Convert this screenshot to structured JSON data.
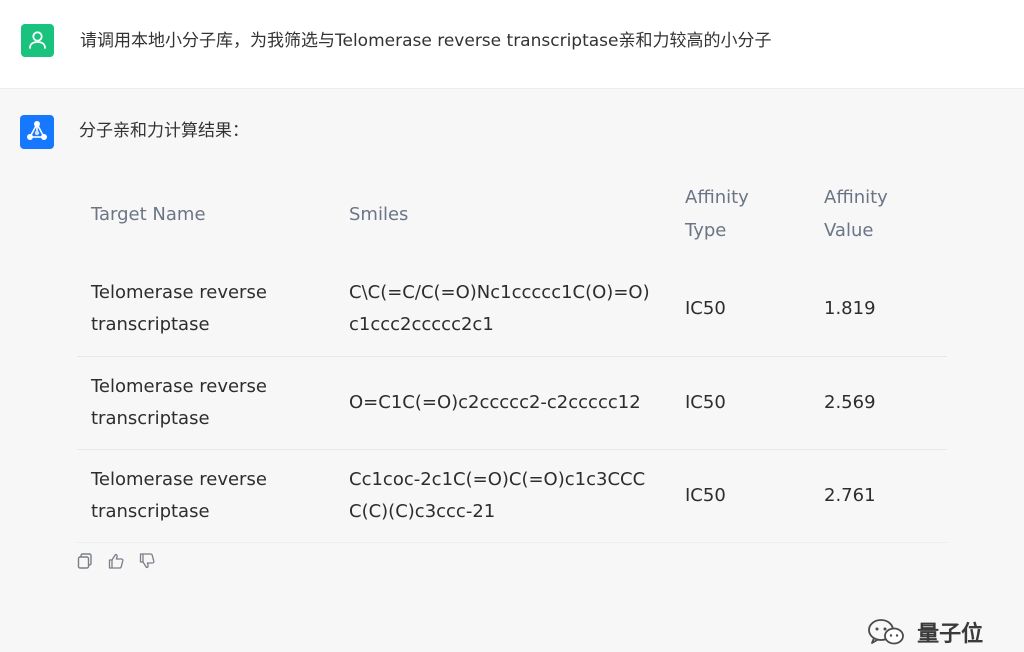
{
  "user_message": {
    "avatar_icon": "user-icon",
    "avatar_color": "#19c37d",
    "text": "请调用本地小分子库，为我筛选与Telomerase reverse transcriptase亲和力较高的小分子"
  },
  "bot_message": {
    "avatar_icon": "molecule-network-icon",
    "avatar_color": "#1677ff",
    "intro": "分子亲和力计算结果：",
    "table": {
      "headers": {
        "target_name": "Target Name",
        "smiles": "Smiles",
        "affinity_type": "Affinity Type",
        "affinity_value": "Affinity Value"
      },
      "rows": [
        {
          "target_name": "Telomerase reverse transcriptase",
          "smiles": "C\\C(=C/C(=O)Nc1ccccc1C(O)=O)c1ccc2ccccc2c1",
          "affinity_type": "IC50",
          "affinity_value": "1.819"
        },
        {
          "target_name": "Telomerase reverse transcriptase",
          "smiles": "O=C1C(=O)c2ccccc2-c2ccccc12",
          "affinity_type": "IC50",
          "affinity_value": "2.569"
        },
        {
          "target_name": "Telomerase reverse transcriptase",
          "smiles": "Cc1coc-2c1C(=O)C(=O)c1c3CCCC(C)(C)c3ccc-21",
          "affinity_type": "IC50",
          "affinity_value": "2.761"
        }
      ]
    },
    "feedback_icons": [
      "copy-icon",
      "thumbs-up-icon",
      "thumbs-down-icon"
    ]
  },
  "watermark": {
    "icon": "wechat-icon",
    "text": "量子位"
  }
}
